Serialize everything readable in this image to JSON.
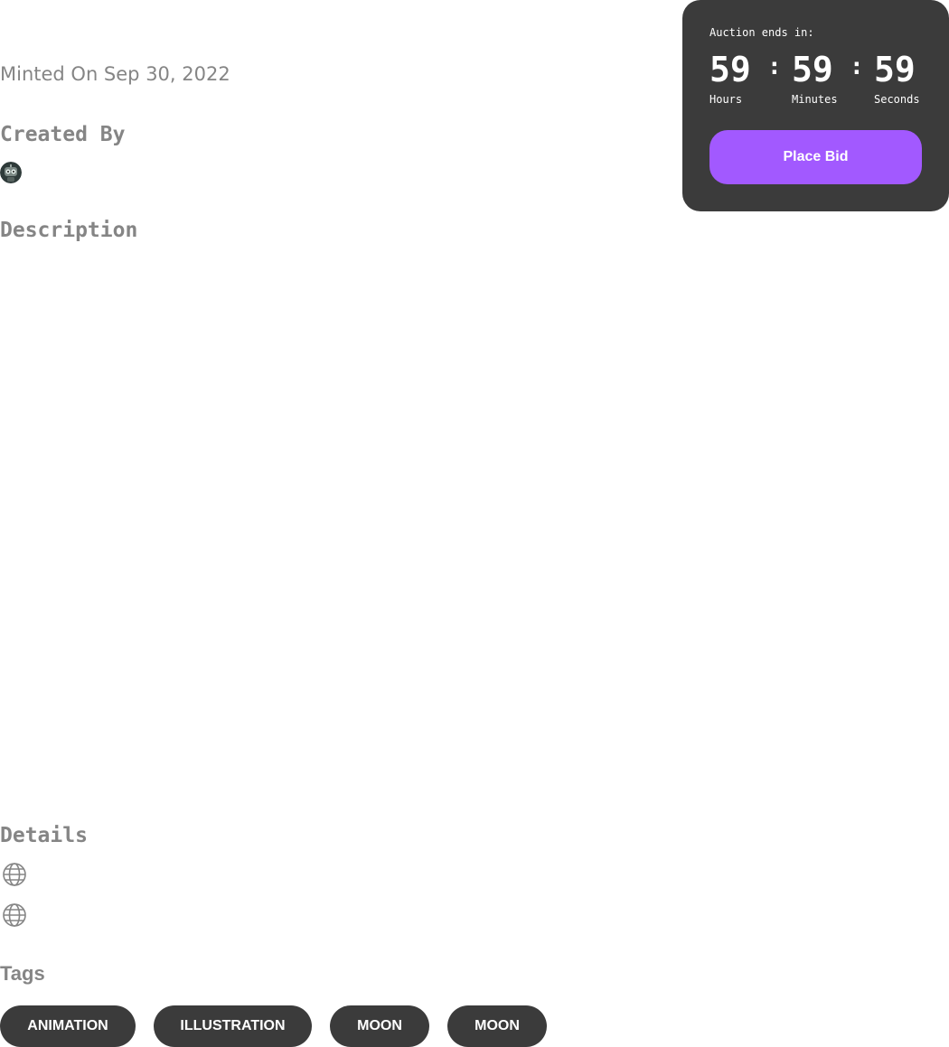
{
  "nft": {
    "minted_on": "Minted On Sep 30, 2022"
  },
  "sections": {
    "created_by": "Created By",
    "description": "Description",
    "details": "Details",
    "tags": "Tags"
  },
  "creator": {
    "avatar_icon": "robot-avatar"
  },
  "details": {
    "links": [
      {
        "icon": "globe-icon"
      },
      {
        "icon": "globe-icon"
      }
    ]
  },
  "tags": [
    "ANIMATION",
    "ILLUSTRATION",
    "MOON",
    "MOON"
  ],
  "auction": {
    "label": "Auction ends in:",
    "hours": "59",
    "minutes": "59",
    "seconds": "59",
    "separator": ":",
    "hours_label": "Hours",
    "minutes_label": "Minutes",
    "seconds_label": "Seconds",
    "button_label": "Place Bid"
  },
  "colors": {
    "card_bg": "#3b3b3b",
    "accent": "#a259ff",
    "muted_text": "#858585"
  }
}
